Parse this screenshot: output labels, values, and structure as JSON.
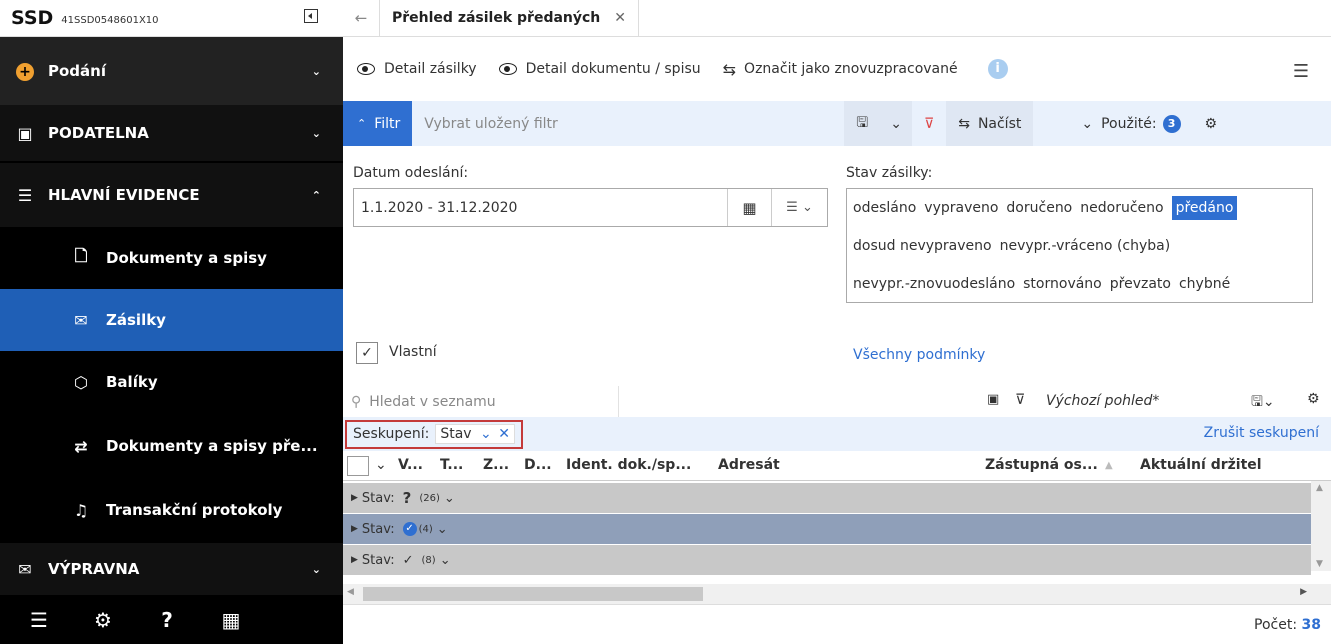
{
  "sidebar": {
    "brand": "SSD",
    "code": "41SSD0548601X10",
    "items": [
      {
        "label": "Podání",
        "icon": "plus-circle-icon"
      },
      {
        "label": "PODATELNA",
        "icon": "inbox-icon"
      },
      {
        "label": "HLAVNÍ EVIDENCE",
        "icon": "list-icon"
      },
      {
        "label": "Dokumenty a spisy",
        "icon": "document-icon"
      },
      {
        "label": "Zásilky",
        "icon": "envelope-icon"
      },
      {
        "label": "Balíky",
        "icon": "package-icon"
      },
      {
        "label": "Dokumenty a spisy pře...",
        "icon": "transfer-icon"
      },
      {
        "label": "Transakční protokoly",
        "icon": "protocol-icon"
      },
      {
        "label": "VÝPRAVNA",
        "icon": "mail-icon"
      }
    ]
  },
  "tab": {
    "title": "Přehled zásilek předaných"
  },
  "toolbar": {
    "detail_shipment": "Detail zásilky",
    "detail_document": "Detail dokumentu / spisu",
    "mark_reprocessed": "Označit jako znovuzpracované"
  },
  "filterbar": {
    "filter_label": "Filtr",
    "saved_placeholder": "Vybrat uložený filtr",
    "load_label": "Načíst",
    "used_label": "Použité:",
    "used_count": "3"
  },
  "filters": {
    "date_label": "Datum odeslání:",
    "date_value": "1.1.2020 - 31.12.2020",
    "state_label": "Stav zásilky:",
    "states_row1": [
      "odesláno",
      "vypraveno",
      "doručeno",
      "nedoručeno"
    ],
    "state_selected": "předáno",
    "states_row2": [
      "dosud nevypraveno",
      "nevypr.-vráceno (chyba)"
    ],
    "states_row3": [
      "nevypr.-znovuodesláno",
      "stornováno",
      "převzato",
      "chybné"
    ],
    "own_label": "Vlastní",
    "all_conditions": "Všechny podmínky"
  },
  "list": {
    "search_placeholder": "Hledat v seznamu",
    "view_name": "Výchozí pohled*",
    "grouping_label": "Seskupení:",
    "grouping_value": "Stav",
    "cancel_grouping": "Zrušit seskupení",
    "columns": [
      "V...",
      "T...",
      "Z...",
      "D...",
      "Ident. dok./sp...",
      "Adresát",
      "Zástupná os...",
      "Aktuální držitel"
    ],
    "groups": [
      {
        "label": "Stav:",
        "value": "?",
        "count": "(26)"
      },
      {
        "label": "Stav:",
        "value": "",
        "count": "(4)"
      },
      {
        "label": "Stav:",
        "value": "✓",
        "count": "(8)"
      }
    ]
  },
  "footer": {
    "count_label": "Počet:",
    "count_value": "38"
  }
}
